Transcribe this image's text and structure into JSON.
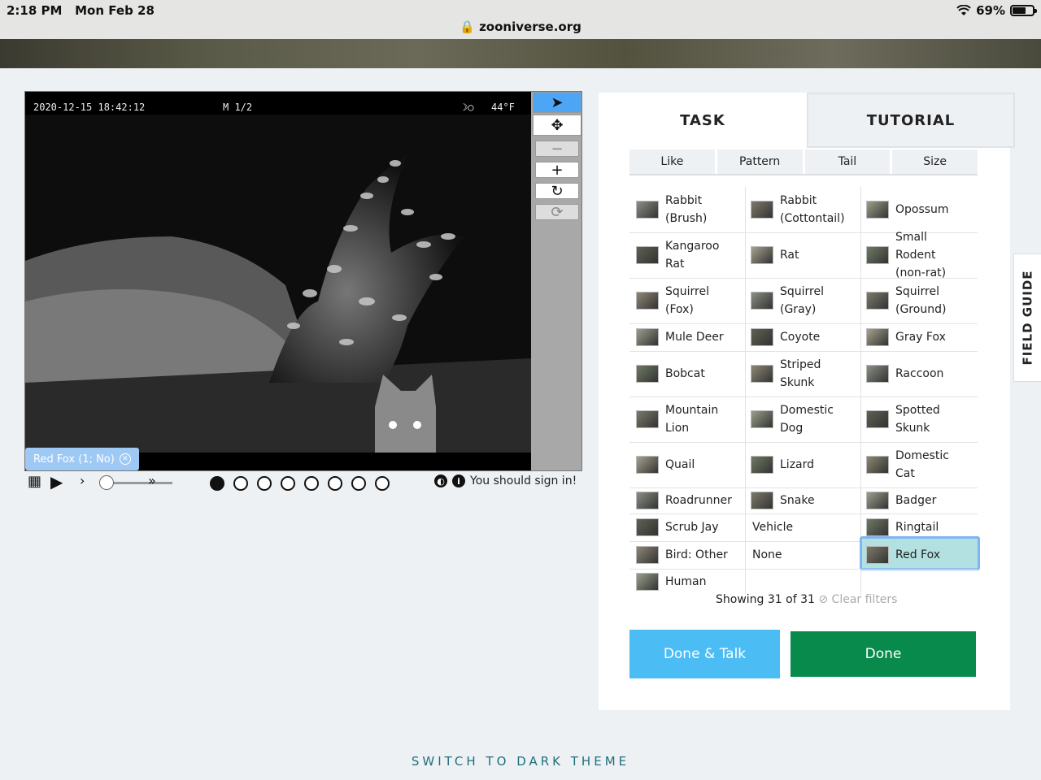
{
  "status_bar": {
    "time": "2:18 PM",
    "date": "Mon Feb 28",
    "battery": "69%",
    "url": "zooniverse.org"
  },
  "viewer": {
    "timestamp": "2020-12-15 18:42:12",
    "mode": "M 1/2",
    "temperature": "44°F",
    "subject_tag": "Red Fox (1; No)",
    "tools": [
      "pointer-icon",
      "move-icon",
      "zoom-out-icon",
      "zoom-in-icon",
      "rotate-icon",
      "reset-icon"
    ]
  },
  "controls": {
    "frames": 8,
    "current_frame": 1,
    "signin_text": "You should sign in!"
  },
  "task_panel": {
    "tabs": [
      "TASK",
      "TUTORIAL"
    ],
    "filters": [
      "Like",
      "Pattern",
      "Tail",
      "Size"
    ],
    "choices": [
      [
        "Rabbit (Brush)",
        "Rabbit (Cottontail)",
        "Opossum"
      ],
      [
        "Kangaroo Rat",
        "Rat",
        "Small Rodent (non-rat)"
      ],
      [
        "Squirrel (Fox)",
        "Squirrel (Gray)",
        "Squirrel (Ground)"
      ],
      [
        "Mule Deer",
        "Coyote",
        "Gray Fox"
      ],
      [
        "Bobcat",
        "Striped Skunk",
        "Raccoon"
      ],
      [
        "Mountain Lion",
        "Domestic Dog",
        "Spotted Skunk"
      ],
      [
        "Quail",
        "Lizard",
        "Domestic Cat"
      ],
      [
        "Roadrunner",
        "Snake",
        "Badger"
      ],
      [
        "Scrub Jay",
        "Vehicle",
        "Ringtail"
      ],
      [
        "Bird: Other",
        "None",
        "Red Fox"
      ],
      [
        "Human",
        "",
        ""
      ]
    ],
    "selected": "Red Fox",
    "showing": "Showing 31 of 31",
    "clear_filters": "Clear filters",
    "done_talk": "Done & Talk",
    "done": "Done"
  },
  "field_guide": "FIELD GUIDE",
  "dark_theme": "SWITCH TO DARK THEME"
}
